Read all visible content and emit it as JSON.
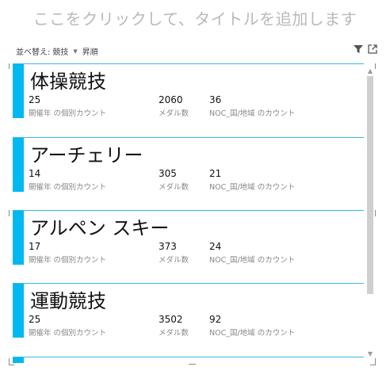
{
  "header": {
    "title_placeholder": "ここをクリックして、タイトルを追加します"
  },
  "sort": {
    "label": "並べ替え:",
    "field": "競技",
    "order": "昇順"
  },
  "icons": [
    "filter-icon",
    "focus-mode-icon"
  ],
  "colors": {
    "accent": "#01b8f0",
    "divider": "#39b7e6",
    "placeholder": "#b9b9b9"
  },
  "labels": {
    "col1": "開催年 の個別カウント",
    "col2": "メダル数",
    "col3": "NOC_国/地域 のカウント"
  },
  "cards": [
    {
      "name": "体操競技",
      "v1": "25",
      "v2": "2060",
      "v3": "36"
    },
    {
      "name": "アーチェリー",
      "v1": "14",
      "v2": "305",
      "v3": "21"
    },
    {
      "name": "アルペン スキー",
      "v1": "17",
      "v2": "373",
      "v3": "24"
    },
    {
      "name": "運動競技",
      "v1": "25",
      "v2": "3502",
      "v3": "92"
    }
  ]
}
